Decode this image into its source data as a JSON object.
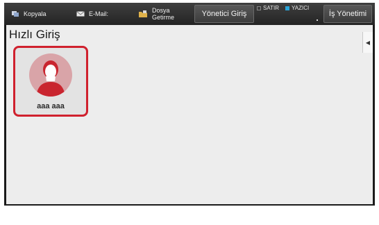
{
  "topbar": {
    "copy_label": "Kopyala",
    "email_label": "E-Mail:",
    "file_retrieval_label_line1": "Dosya",
    "file_retrieval_label_line2": "Getirme",
    "admin_login_label": "Yönetici Giriş",
    "status_line_label": "SATIR",
    "status_printer_label": "YAZICI",
    "job_management_label": "İş Yönetimi"
  },
  "main": {
    "title": "Hızlı Giriş",
    "users": [
      {
        "name": "aaa aaa"
      }
    ]
  },
  "colors": {
    "selected_border": "#d0212e",
    "avatar_bg": "#d9a4a8",
    "avatar_figure": "#c9252f",
    "printer_indicator": "#2aa4d8"
  }
}
